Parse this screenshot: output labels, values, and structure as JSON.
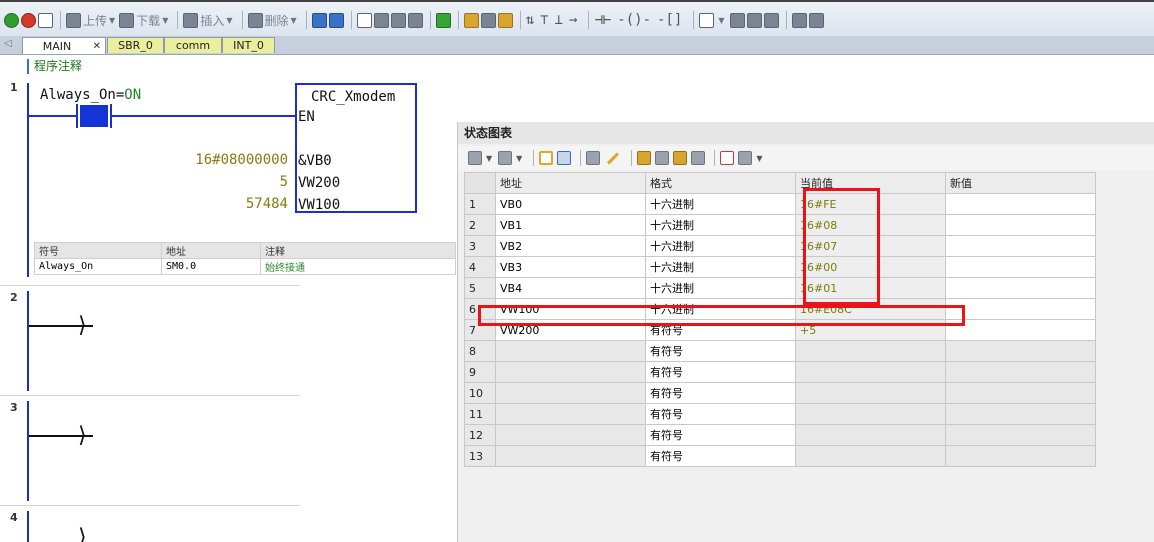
{
  "toolbar": {
    "upload_label": "上传",
    "download_label": "下载",
    "insert_label": "插入",
    "delete_label": "删除"
  },
  "tabs": [
    {
      "label": "MAIN"
    },
    {
      "label": "SBR_0"
    },
    {
      "label": "comm"
    },
    {
      "label": "INT_0"
    }
  ],
  "editor": {
    "comment": "程序注释",
    "networks": [
      {
        "number": "1",
        "contact_text": "Always_On=",
        "contact_state": "ON",
        "block_name": "CRC_Xmodem",
        "en_label": "EN",
        "params": [
          {
            "value": "16#08000000",
            "name": "&VB0"
          },
          {
            "value": "5",
            "name": "VW200"
          },
          {
            "value": "57484",
            "name": "VW100"
          }
        ],
        "symbol_table": {
          "headers": [
            "符号",
            "地址",
            "注释"
          ],
          "rows": [
            {
              "symbol": "Always_On",
              "address": "SM0.0",
              "comment": "始终接通"
            }
          ]
        }
      },
      {
        "number": "2"
      },
      {
        "number": "3"
      },
      {
        "number": "4"
      }
    ]
  },
  "status_chart": {
    "title": "状态图表",
    "columns": {
      "address": "地址",
      "format": "格式",
      "current": "当前值",
      "new": "新值"
    },
    "rows": [
      {
        "n": "1",
        "address": "VB0",
        "format": "十六进制",
        "current": "16#FE",
        "new": ""
      },
      {
        "n": "2",
        "address": "VB1",
        "format": "十六进制",
        "current": "16#08",
        "new": ""
      },
      {
        "n": "3",
        "address": "VB2",
        "format": "十六进制",
        "current": "16#07",
        "new": ""
      },
      {
        "n": "4",
        "address": "VB3",
        "format": "十六进制",
        "current": "16#00",
        "new": ""
      },
      {
        "n": "5",
        "address": "VB4",
        "format": "十六进制",
        "current": "16#01",
        "new": ""
      },
      {
        "n": "6",
        "address": "VW100",
        "format": "十六进制",
        "current": "16#E08C",
        "new": ""
      },
      {
        "n": "7",
        "address": "VW200",
        "format": "有符号",
        "current": "+5",
        "new": ""
      },
      {
        "n": "8",
        "address": "",
        "format": "有符号",
        "current": "",
        "new": ""
      },
      {
        "n": "9",
        "address": "",
        "format": "有符号",
        "current": "",
        "new": ""
      },
      {
        "n": "10",
        "address": "",
        "format": "有符号",
        "current": "",
        "new": ""
      },
      {
        "n": "11",
        "address": "",
        "format": "有符号",
        "current": "",
        "new": ""
      },
      {
        "n": "12",
        "address": "",
        "format": "有符号",
        "current": "",
        "new": ""
      },
      {
        "n": "13",
        "address": "",
        "format": "有符号",
        "current": "",
        "new": ""
      }
    ]
  },
  "colors": {
    "highlight_red": "#e8141a",
    "ladder_blue": "#1a2fd0",
    "value_olive": "#7a7a0c",
    "comment_green": "#1a7a1a"
  }
}
